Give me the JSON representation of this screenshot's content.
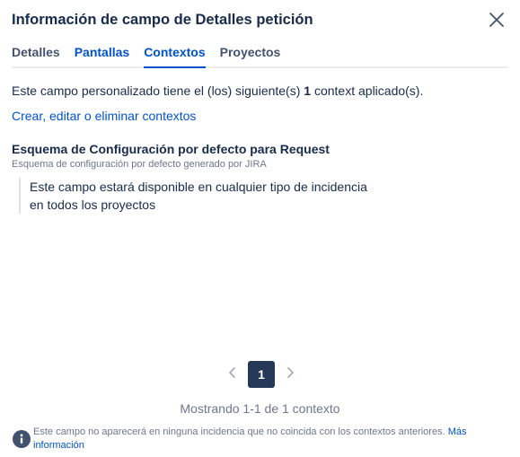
{
  "dialog": {
    "title": "Información de campo de Detalles petición"
  },
  "tabs": [
    {
      "label": "Detalles"
    },
    {
      "label": "Pantallas"
    },
    {
      "label": "Contextos"
    },
    {
      "label": "Proyectos"
    }
  ],
  "summary": {
    "prefix": "Este campo personalizado tiene el (los) siguiente(s) ",
    "count": "1",
    "suffix": " context aplicado(s)."
  },
  "manage_link": "Crear, editar o eliminar contextos",
  "scheme": {
    "name": "Esquema de Configuración por defecto para Request",
    "description": "Esquema de configuración por defecto generado por JIRA",
    "scope_line1": "Este campo estará disponible en cualquier tipo de incidencia",
    "scope_line2": "en todos los proyectos"
  },
  "pagination": {
    "current_page": "1",
    "showing_text": "Mostrando 1-1 de 1 contexto"
  },
  "footer": {
    "info_text": "Este campo no aparecerá en ninguna incidencia que no coincida con los contextos anteriores.",
    "more_link": "Más información"
  },
  "colors": {
    "text": "#172b4d",
    "link": "#0052cc",
    "muted": "#6b778c",
    "current_page_bg": "#253858",
    "info_icon": "#42526e"
  },
  "icons": {
    "close": "close-icon",
    "prev": "chevron-left-icon",
    "next": "chevron-right-icon",
    "info": "info-icon"
  }
}
